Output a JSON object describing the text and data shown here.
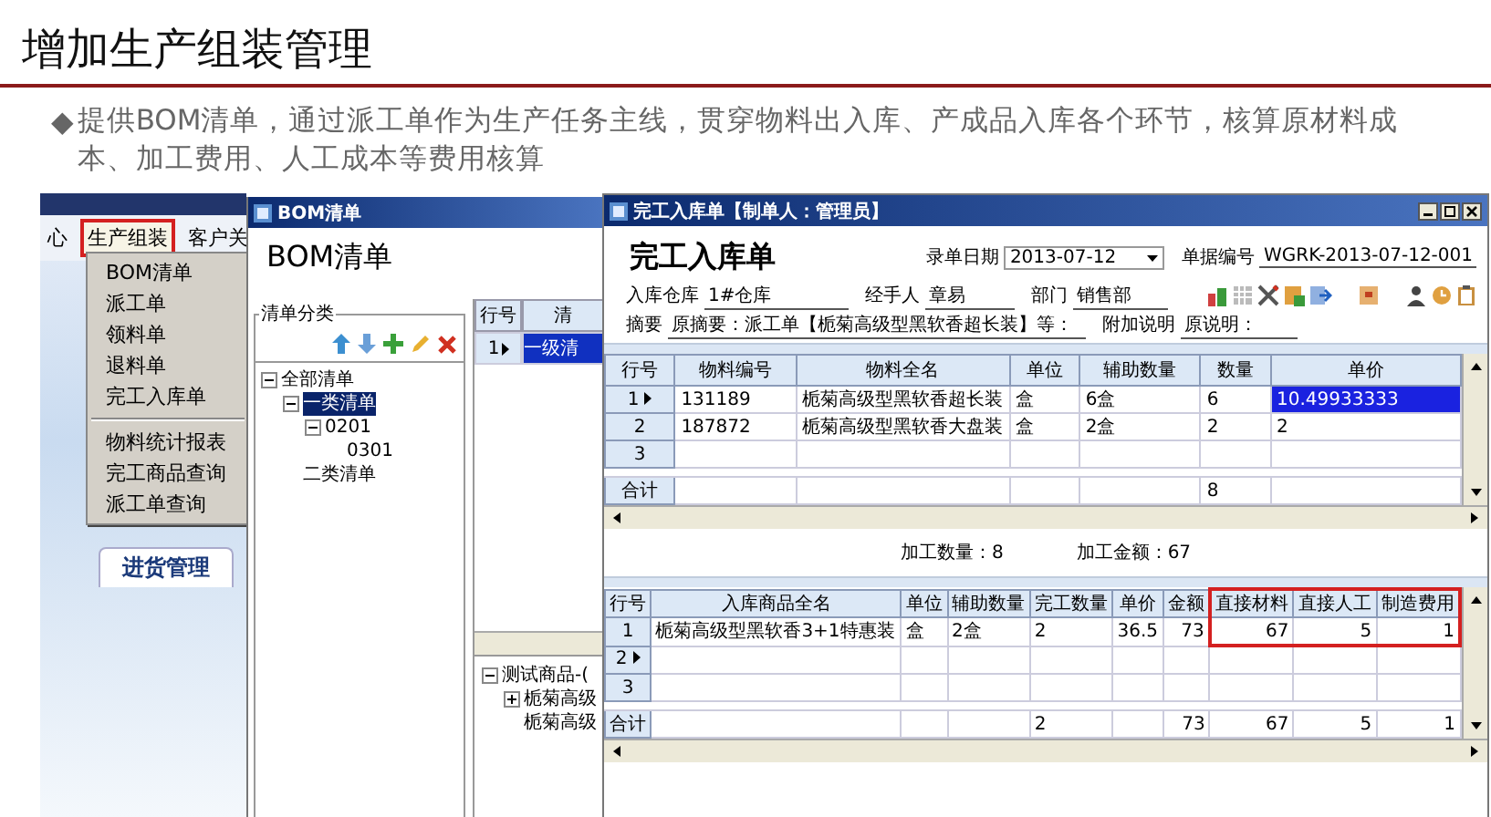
{
  "slide": {
    "title": "增加生产组装管理",
    "bullet_marker": "◆",
    "bullet": "提供BOM清单，通过派工单作为生产任务主线，贯穿物料出入库、产成品入库各个环节，核算原材料成本、加工费用、人工成本等费用核算"
  },
  "left_app": {
    "menu_bar": [
      {
        "label": "心",
        "selected": false
      },
      {
        "label": "生产组装",
        "selected": true
      },
      {
        "label": "客户关",
        "selected": false
      }
    ],
    "dropdown_groups": [
      [
        "BOM清单",
        "派工单",
        "领料单",
        "退料单",
        "完工入库单"
      ],
      [
        "物料统计报表",
        "完工商品查询",
        "派工单查询"
      ]
    ],
    "tab": "进货管理"
  },
  "bom_window": {
    "title": "BOM清单",
    "heading": "BOM清单",
    "group_label": "清单分类",
    "tree": [
      {
        "label": "全部清单",
        "expanded": true,
        "selected": false,
        "children": [
          {
            "label": "一类清单",
            "expanded": true,
            "selected": true,
            "children": [
              {
                "label": "0201",
                "expanded": true,
                "selected": false,
                "children": [
                  {
                    "label": "0301",
                    "selected": false
                  }
                ]
              }
            ]
          },
          {
            "label": "二类清单",
            "selected": false
          }
        ]
      }
    ],
    "grid": {
      "columns": [
        "行号",
        "清"
      ],
      "rows": [
        {
          "cells": [
            "1",
            "一级清"
          ],
          "selected": true
        }
      ]
    },
    "lower_tree": [
      {
        "label": "测试商品-(",
        "expanded": true,
        "children": [
          {
            "label": "栀菊高级",
            "expanded": false
          },
          {
            "label": "栀菊高级"
          }
        ]
      }
    ]
  },
  "main_window": {
    "title": "完工入库单【制单人：管理员】",
    "heading": "完工入库单",
    "date": {
      "label": "录单日期",
      "value": "2013-07-12"
    },
    "number": {
      "label": "单据编号",
      "value": "WGRK-2013-07-12-001"
    },
    "warehouse": {
      "label": "入库仓库",
      "value": "1#仓库"
    },
    "handler": {
      "label": "经手人",
      "value": "章易"
    },
    "department": {
      "label": "部门",
      "value": "销售部"
    },
    "summary": {
      "label": "摘要",
      "value": "原摘要：派工单【栀菊高级型黑软香超长装】等："
    },
    "note": {
      "label": "附加说明",
      "value": "原说明："
    },
    "top_table": {
      "columns": [
        {
          "label": "行号"
        },
        {
          "label": "物料编号"
        },
        {
          "label": "物料全名"
        },
        {
          "label": "单位"
        },
        {
          "label": "辅助数量"
        },
        {
          "label": "数量"
        },
        {
          "label": "单价"
        }
      ],
      "rows": [
        {
          "kind": "data",
          "selected": true,
          "cells": [
            "1",
            "131189",
            "栀菊高级型黑软香超长装",
            "盒",
            "6盒",
            "6",
            {
              "text": "10.49933333",
              "selected": true
            }
          ]
        },
        {
          "kind": "data",
          "selected": false,
          "cells": [
            "2",
            "187872",
            "栀菊高级型黑软香大盘装",
            "盒",
            "2盒",
            "2",
            "2"
          ]
        },
        {
          "kind": "data",
          "selected": false,
          "cells": [
            "3",
            "",
            "",
            "",
            "",
            "",
            ""
          ]
        },
        {
          "kind": "total",
          "cells": [
            "合计",
            "",
            "",
            "",
            "",
            "8",
            ""
          ]
        }
      ]
    },
    "totals": [
      {
        "label": "加工数量：",
        "value": "8"
      },
      {
        "label": "加工金额：",
        "value": "67"
      }
    ],
    "bottom_table": {
      "columns": [
        {
          "label": "行号",
          "highlighted": false
        },
        {
          "label": "入库商品全名",
          "highlighted": false
        },
        {
          "label": "单位",
          "highlighted": false
        },
        {
          "label": "辅助数量",
          "highlighted": false
        },
        {
          "label": "完工数量",
          "highlighted": false
        },
        {
          "label": "单价",
          "highlighted": false
        },
        {
          "label": "金额",
          "highlighted": false
        },
        {
          "label": "直接材料",
          "highlighted": true
        },
        {
          "label": "直接人工",
          "highlighted": true
        },
        {
          "label": "制造费用",
          "highlighted": true
        }
      ],
      "rows": [
        {
          "kind": "data",
          "selected": false,
          "cells": [
            "1",
            "栀菊高级型黑软香3+1特惠装",
            "盒",
            "2盒",
            "2",
            "36.5",
            "73",
            "67",
            "5",
            "1"
          ]
        },
        {
          "kind": "data",
          "selected": true,
          "cells": [
            "2",
            "",
            "",
            "",
            "",
            "",
            "",
            "",
            "",
            ""
          ]
        },
        {
          "kind": "data",
          "selected": false,
          "cells": [
            "3",
            "",
            "",
            "",
            "",
            "",
            "",
            "",
            "",
            ""
          ]
        },
        {
          "kind": "total",
          "cells": [
            "合计",
            "",
            "",
            "",
            "2",
            "",
            "73",
            "67",
            "5",
            "1"
          ]
        }
      ]
    }
  }
}
